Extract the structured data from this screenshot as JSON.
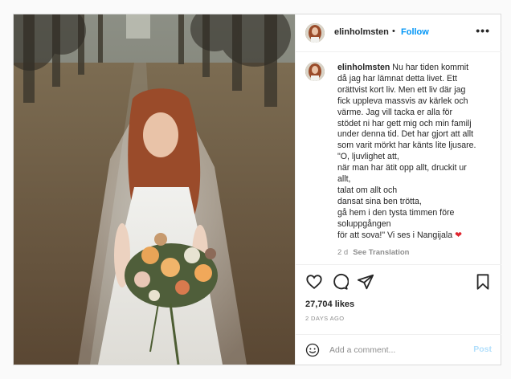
{
  "post": {
    "username": "elinholmsten",
    "separator": "•",
    "follow_label": "Follow",
    "more_label": "•••",
    "caption_lines": [
      "Nu har tiden kommit",
      "då jag har lämnat detta livet. Ett",
      "orättvist kort liv. Men ett liv där jag",
      "fick uppleva massvis av kärlek och",
      "värme. Jag vill tacka er alla för",
      "stödet ni har gett mig och min familj",
      "under denna tid. Det har gjort att allt",
      "som varit mörkt har känts lite ljusare.",
      "\"O, ljuvlighet att,",
      "när man har ätit opp allt, druckit ur",
      "allt,",
      "talat om allt och",
      "dansat sina ben trötta,",
      "gå hem i den tysta timmen före",
      "soluppgången",
      "för att sova!\" Vi ses i Nangijala"
    ],
    "caption_emoji": "❤",
    "time_ago": "2 d",
    "see_translation": "See Translation",
    "likes": "27,704 likes",
    "date": "2 DAYS AGO",
    "comment_placeholder": "Add a comment...",
    "post_label": "Post",
    "icons": {
      "like": "heart-outline-icon",
      "comment": "comment-bubble-icon",
      "share": "paper-plane-icon",
      "save": "bookmark-icon",
      "emoji": "smiley-icon"
    },
    "colors": {
      "follow": "#0095f6",
      "post_disabled": "#b2dffc",
      "muted": "#8e8e8e",
      "heart": "#e0262f"
    }
  }
}
